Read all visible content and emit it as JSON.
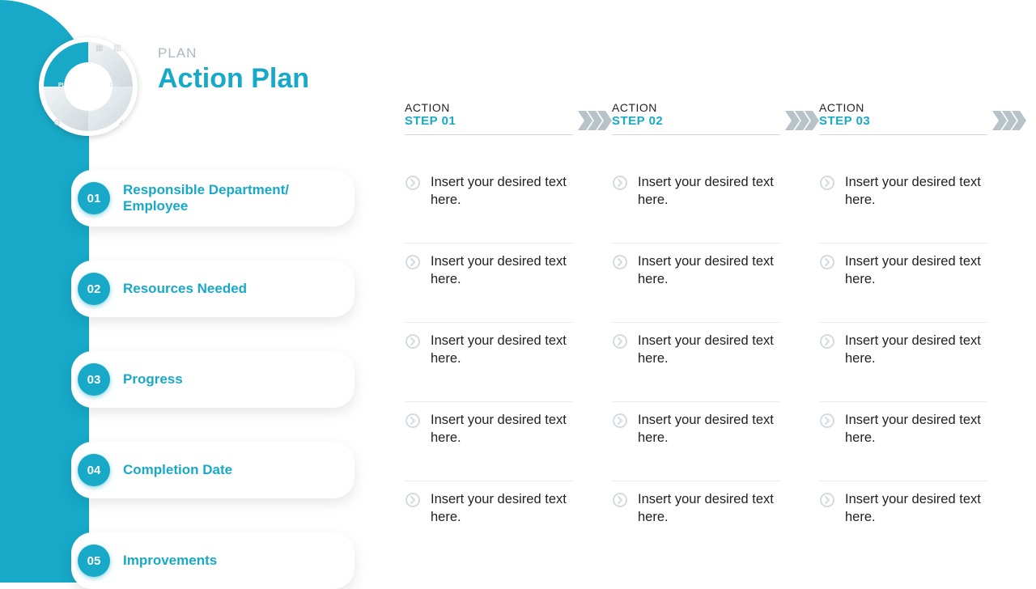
{
  "accent": "#17a9c7",
  "header": {
    "eyebrow": "PLAN",
    "title": "Action Plan"
  },
  "wheel": {
    "labels": {
      "plan": "PLAN",
      "do": "DO",
      "check": "CHECK",
      "act": "ACT"
    }
  },
  "rows": [
    {
      "num": "01",
      "label": "Responsible Department/  Employee"
    },
    {
      "num": "02",
      "label": "Resources  Needed"
    },
    {
      "num": "03",
      "label": "Progress"
    },
    {
      "num": "04",
      "label": "Completion Date"
    },
    {
      "num": "05",
      "label": "Improvements"
    }
  ],
  "steps": [
    {
      "action_label": "ACTION",
      "step_label": "STEP 01",
      "cells": [
        "Insert your desired text here.",
        "Insert your desired text here.",
        "Insert your desired text here.",
        "Insert your desired text here.",
        "Insert your desired text here."
      ]
    },
    {
      "action_label": "ACTION",
      "step_label": "STEP 02",
      "cells": [
        "Insert your desired text here.",
        "Insert your desired text here.",
        "Insert your desired text here.",
        "Insert your desired text here.",
        "Insert your desired text here."
      ]
    },
    {
      "action_label": "ACTION",
      "step_label": "STEP 03",
      "cells": [
        "Insert your desired text here.",
        "Insert your desired text here.",
        "Insert your desired text here.",
        "Insert your desired text here.",
        "Insert your desired text here."
      ]
    }
  ]
}
